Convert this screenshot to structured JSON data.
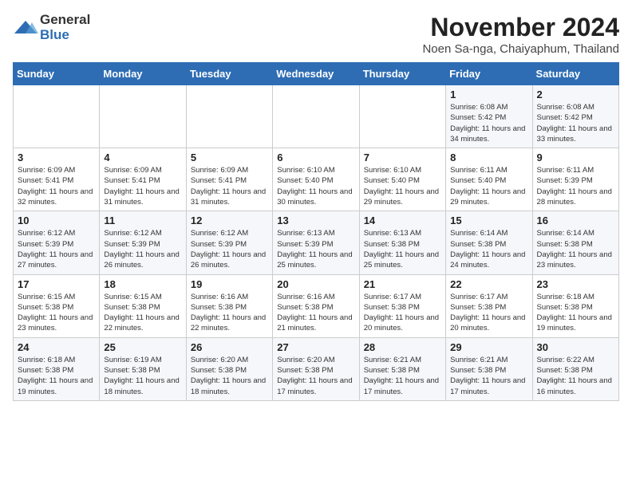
{
  "logo": {
    "general": "General",
    "blue": "Blue"
  },
  "title": "November 2024",
  "subtitle": "Noen Sa-nga, Chaiyaphum, Thailand",
  "days_header": [
    "Sunday",
    "Monday",
    "Tuesday",
    "Wednesday",
    "Thursday",
    "Friday",
    "Saturday"
  ],
  "weeks": [
    [
      {
        "day": "",
        "info": ""
      },
      {
        "day": "",
        "info": ""
      },
      {
        "day": "",
        "info": ""
      },
      {
        "day": "",
        "info": ""
      },
      {
        "day": "",
        "info": ""
      },
      {
        "day": "1",
        "info": "Sunrise: 6:08 AM\nSunset: 5:42 PM\nDaylight: 11 hours and 34 minutes."
      },
      {
        "day": "2",
        "info": "Sunrise: 6:08 AM\nSunset: 5:42 PM\nDaylight: 11 hours and 33 minutes."
      }
    ],
    [
      {
        "day": "3",
        "info": "Sunrise: 6:09 AM\nSunset: 5:41 PM\nDaylight: 11 hours and 32 minutes."
      },
      {
        "day": "4",
        "info": "Sunrise: 6:09 AM\nSunset: 5:41 PM\nDaylight: 11 hours and 31 minutes."
      },
      {
        "day": "5",
        "info": "Sunrise: 6:09 AM\nSunset: 5:41 PM\nDaylight: 11 hours and 31 minutes."
      },
      {
        "day": "6",
        "info": "Sunrise: 6:10 AM\nSunset: 5:40 PM\nDaylight: 11 hours and 30 minutes."
      },
      {
        "day": "7",
        "info": "Sunrise: 6:10 AM\nSunset: 5:40 PM\nDaylight: 11 hours and 29 minutes."
      },
      {
        "day": "8",
        "info": "Sunrise: 6:11 AM\nSunset: 5:40 PM\nDaylight: 11 hours and 29 minutes."
      },
      {
        "day": "9",
        "info": "Sunrise: 6:11 AM\nSunset: 5:39 PM\nDaylight: 11 hours and 28 minutes."
      }
    ],
    [
      {
        "day": "10",
        "info": "Sunrise: 6:12 AM\nSunset: 5:39 PM\nDaylight: 11 hours and 27 minutes."
      },
      {
        "day": "11",
        "info": "Sunrise: 6:12 AM\nSunset: 5:39 PM\nDaylight: 11 hours and 26 minutes."
      },
      {
        "day": "12",
        "info": "Sunrise: 6:12 AM\nSunset: 5:39 PM\nDaylight: 11 hours and 26 minutes."
      },
      {
        "day": "13",
        "info": "Sunrise: 6:13 AM\nSunset: 5:39 PM\nDaylight: 11 hours and 25 minutes."
      },
      {
        "day": "14",
        "info": "Sunrise: 6:13 AM\nSunset: 5:38 PM\nDaylight: 11 hours and 25 minutes."
      },
      {
        "day": "15",
        "info": "Sunrise: 6:14 AM\nSunset: 5:38 PM\nDaylight: 11 hours and 24 minutes."
      },
      {
        "day": "16",
        "info": "Sunrise: 6:14 AM\nSunset: 5:38 PM\nDaylight: 11 hours and 23 minutes."
      }
    ],
    [
      {
        "day": "17",
        "info": "Sunrise: 6:15 AM\nSunset: 5:38 PM\nDaylight: 11 hours and 23 minutes."
      },
      {
        "day": "18",
        "info": "Sunrise: 6:15 AM\nSunset: 5:38 PM\nDaylight: 11 hours and 22 minutes."
      },
      {
        "day": "19",
        "info": "Sunrise: 6:16 AM\nSunset: 5:38 PM\nDaylight: 11 hours and 22 minutes."
      },
      {
        "day": "20",
        "info": "Sunrise: 6:16 AM\nSunset: 5:38 PM\nDaylight: 11 hours and 21 minutes."
      },
      {
        "day": "21",
        "info": "Sunrise: 6:17 AM\nSunset: 5:38 PM\nDaylight: 11 hours and 20 minutes."
      },
      {
        "day": "22",
        "info": "Sunrise: 6:17 AM\nSunset: 5:38 PM\nDaylight: 11 hours and 20 minutes."
      },
      {
        "day": "23",
        "info": "Sunrise: 6:18 AM\nSunset: 5:38 PM\nDaylight: 11 hours and 19 minutes."
      }
    ],
    [
      {
        "day": "24",
        "info": "Sunrise: 6:18 AM\nSunset: 5:38 PM\nDaylight: 11 hours and 19 minutes."
      },
      {
        "day": "25",
        "info": "Sunrise: 6:19 AM\nSunset: 5:38 PM\nDaylight: 11 hours and 18 minutes."
      },
      {
        "day": "26",
        "info": "Sunrise: 6:20 AM\nSunset: 5:38 PM\nDaylight: 11 hours and 18 minutes."
      },
      {
        "day": "27",
        "info": "Sunrise: 6:20 AM\nSunset: 5:38 PM\nDaylight: 11 hours and 17 minutes."
      },
      {
        "day": "28",
        "info": "Sunrise: 6:21 AM\nSunset: 5:38 PM\nDaylight: 11 hours and 17 minutes."
      },
      {
        "day": "29",
        "info": "Sunrise: 6:21 AM\nSunset: 5:38 PM\nDaylight: 11 hours and 17 minutes."
      },
      {
        "day": "30",
        "info": "Sunrise: 6:22 AM\nSunset: 5:38 PM\nDaylight: 11 hours and 16 minutes."
      }
    ]
  ]
}
